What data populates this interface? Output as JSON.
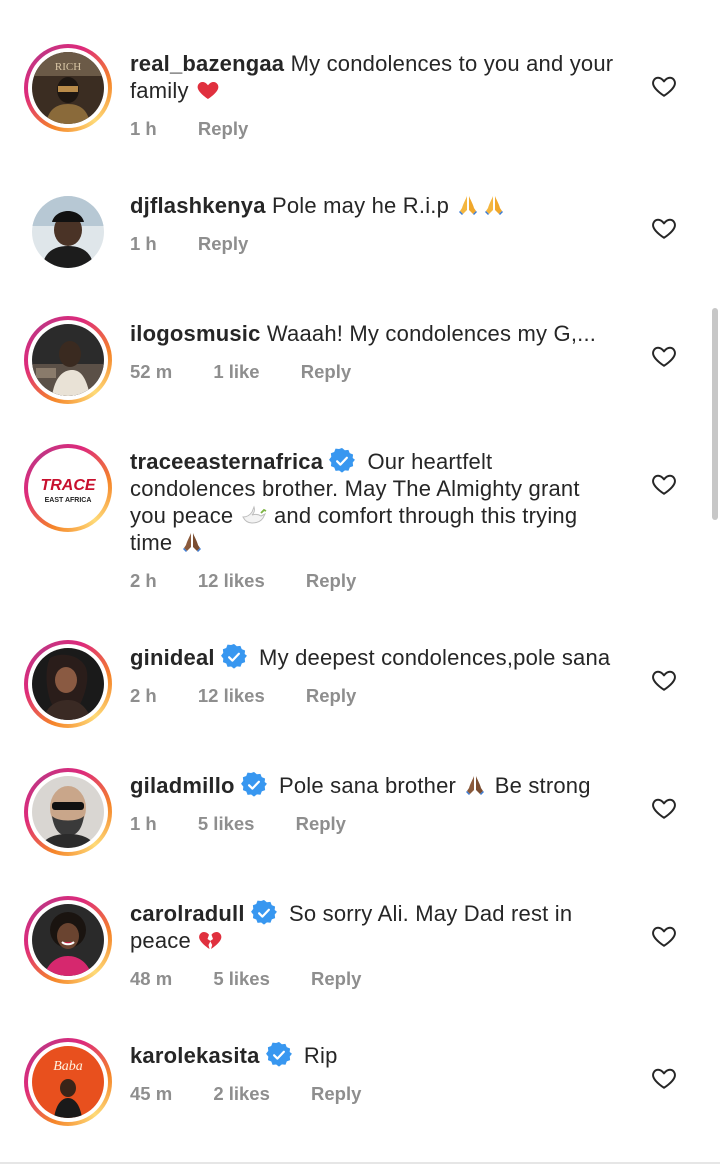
{
  "comments": [
    {
      "user": "real_bazengaa",
      "text": "My condolences to you and your",
      "text2": "family",
      "time": "1 h",
      "likes": "",
      "reply": "Reply"
    },
    {
      "user": "djflashkenya",
      "text": "Pole may he R.i.p",
      "time": "1 h",
      "likes": "",
      "reply": "Reply"
    },
    {
      "user": "ilogosmusic",
      "text": "Waaah! My condolences my G,...",
      "time": "52 m",
      "likes": "1 like",
      "reply": "Reply"
    },
    {
      "user": "traceeasternafrica",
      "text": "Our heartfelt",
      "line2": "condolences brother. May The Almighty grant",
      "line3a": "you peace",
      "line3b": "and comfort through this trying",
      "line4": "time",
      "time": "2 h",
      "likes": "12 likes",
      "reply": "Reply",
      "logo_top": "TRACE",
      "logo_bottom": "EAST AFRICA"
    },
    {
      "user": "ginideal",
      "text": "My deepest condolences,pole sana",
      "time": "2 h",
      "likes": "12 likes",
      "reply": "Reply"
    },
    {
      "user": "giladmillo",
      "text": "Pole sana brother",
      "text2": "Be strong",
      "time": "1 h",
      "likes": "5 likes",
      "reply": "Reply"
    },
    {
      "user": "carolradull",
      "text": "So sorry Ali. May Dad rest in",
      "text2": "peace",
      "time": "48 m",
      "likes": "5 likes",
      "reply": "Reply"
    },
    {
      "user": "karolekasita",
      "text": "Rip",
      "time": "45 m",
      "likes": "2 likes",
      "reply": "Reply",
      "logo_text": "Baba"
    }
  ],
  "colors": {
    "verified": "#3897f0",
    "meta": "#8e8e8e",
    "text": "#262626",
    "heart_red": "#e0303e"
  }
}
